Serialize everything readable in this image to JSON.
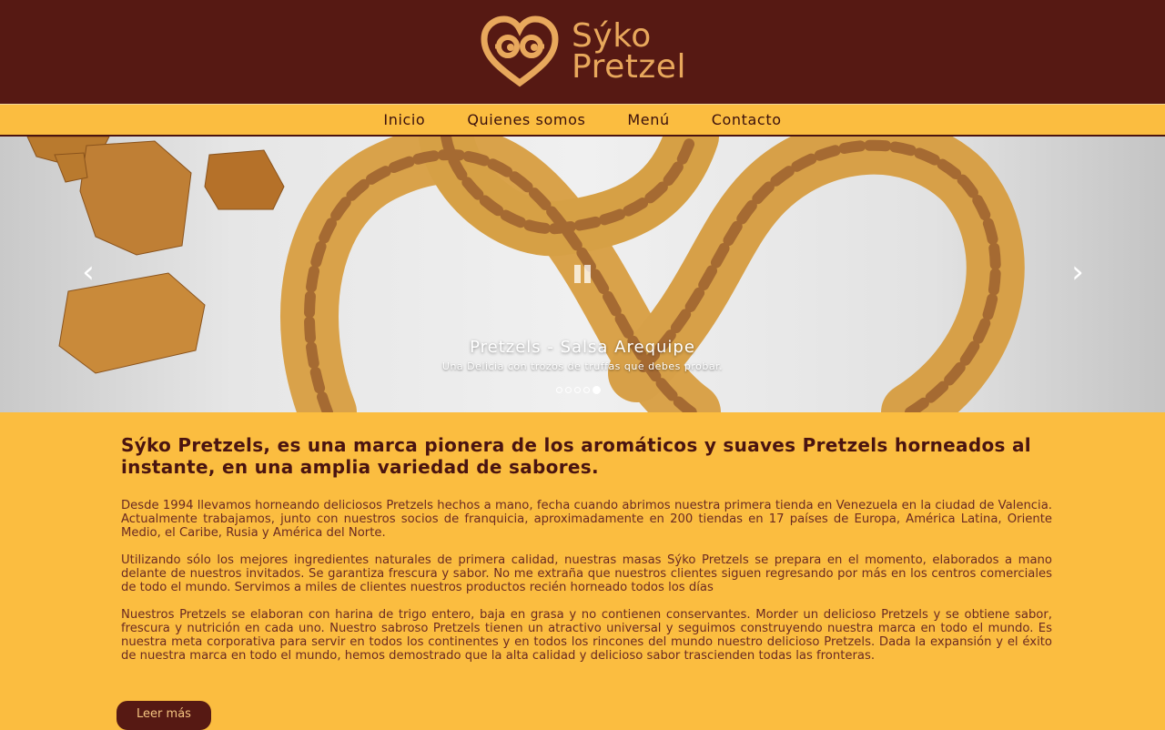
{
  "brand": {
    "line1": "Sýko",
    "line2": "Pretzel"
  },
  "nav": [
    "Inicio",
    "Quienes somos",
    "Menú",
    "Contacto"
  ],
  "slider": {
    "title": "Pretzels - Salsa Arequipe",
    "subtitle": "Una Delicia con trozos de truffas que debes probar.",
    "dot_count": 5,
    "active_dot": 5,
    "prev_icon": "chevron-left-icon",
    "next_icon": "chevron-right-icon",
    "pause_icon": "pause-icon"
  },
  "content": {
    "heading": "Sýko Pretzels, es una marca pionera de los aromáticos y suaves Pretzels horneados al instante, en una amplia variedad de sabores.",
    "paragraphs": [
      "Desde 1994 llevamos horneando deliciosos Pretzels hechos a mano, fecha cuando abrimos nuestra primera tienda en Venezuela en la ciudad de Valencia. Actualmente trabajamos, junto con nuestros socios de franquicia, aproximadamente en 200 tiendas en 17 países de Europa, América Latina, Oriente Medio, el Caribe, Rusia y América del Norte.",
      "Utilizando sólo los mejores ingredientes naturales de primera calidad, nuestras masas Sýko Pretzels se prepara en el momento, elaborados a mano delante de nuestros invitados. Se garantiza frescura y sabor. No me extraña que nuestros clientes siguen regresando por más en los centros comerciales de todo el mundo. Servimos a miles de clientes nuestros productos recién horneado todos los días",
      "Nuestros Pretzels se elaboran con harina de trigo entero, baja en grasa y no contienen conservantes. Morder un delicioso Pretzels y se obtiene sabor, frescura y nutrición en cada uno. Nuestro sabroso Pretzels tienen un atractivo universal y seguimos construyendo nuestra marca en todo el mundo. Es nuestra meta corporativa para servir en todos los continentes y en todos los rincones del mundo nuestro delicioso Pretzels. Dada la expansión y el éxito de nuestra marca en todo el mundo, hemos demostrado que la alta calidad y delicioso sabor trascienden todas las fronteras."
    ],
    "button": "Leer más"
  },
  "colors": {
    "header_bg": "#561913",
    "page_bg": "#fbbd40",
    "logo": "#e8a85c",
    "text": "#4a1410"
  }
}
